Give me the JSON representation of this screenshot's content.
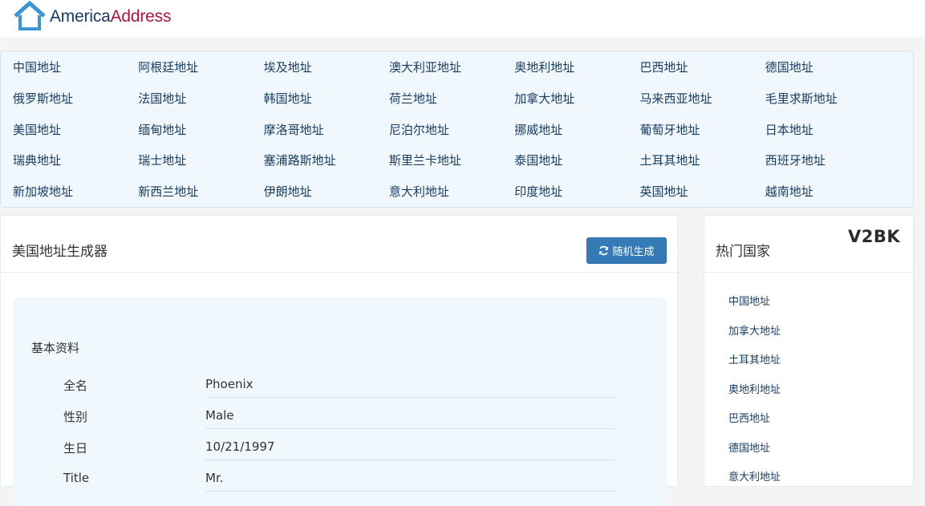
{
  "header": {
    "brand_part1": "America",
    "brand_part2": "Address",
    "logo_icon": "house-icon"
  },
  "country_nav": [
    [
      "中国地址",
      "阿根廷地址",
      "埃及地址",
      "澳大利亚地址",
      "奥地利地址",
      "巴西地址",
      "德国地址"
    ],
    [
      "俄罗斯地址",
      "法国地址",
      "韩国地址",
      "荷兰地址",
      "加拿大地址",
      "马来西亚地址",
      "毛里求斯地址"
    ],
    [
      "美国地址",
      "缅甸地址",
      "摩洛哥地址",
      "尼泊尔地址",
      "挪威地址",
      "葡萄牙地址",
      "日本地址"
    ],
    [
      "瑞典地址",
      "瑞士地址",
      "塞浦路斯地址",
      "斯里兰卡地址",
      "泰国地址",
      "土耳其地址",
      "西班牙地址"
    ],
    [
      "新加坡地址",
      "新西兰地址",
      "伊朗地址",
      "意大利地址",
      "印度地址",
      "英国地址",
      "越南地址"
    ]
  ],
  "main": {
    "title": "美国地址生成器",
    "random_button": "随机生成",
    "random_icon": "refresh-icon",
    "section_title": "基本资料",
    "rows": [
      {
        "label": "全名",
        "value": "Phoenix"
      },
      {
        "label": "性别",
        "value": "Male"
      },
      {
        "label": "生日",
        "value": "10/21/1997"
      },
      {
        "label": "Title",
        "value": "Mr."
      }
    ]
  },
  "sidebar": {
    "title": "热门国家",
    "logo_text": "V2BK",
    "links": [
      "中国地址",
      "加拿大地址",
      "土耳其地址",
      "奥地利地址",
      "巴西地址",
      "德国地址",
      "意大利地址"
    ]
  },
  "colors": {
    "accent": "#337ab7",
    "brand_dark": "#173a67",
    "brand_red": "#b3123c",
    "link": "#1a3d63",
    "panel_bg": "#f0f7fd"
  }
}
